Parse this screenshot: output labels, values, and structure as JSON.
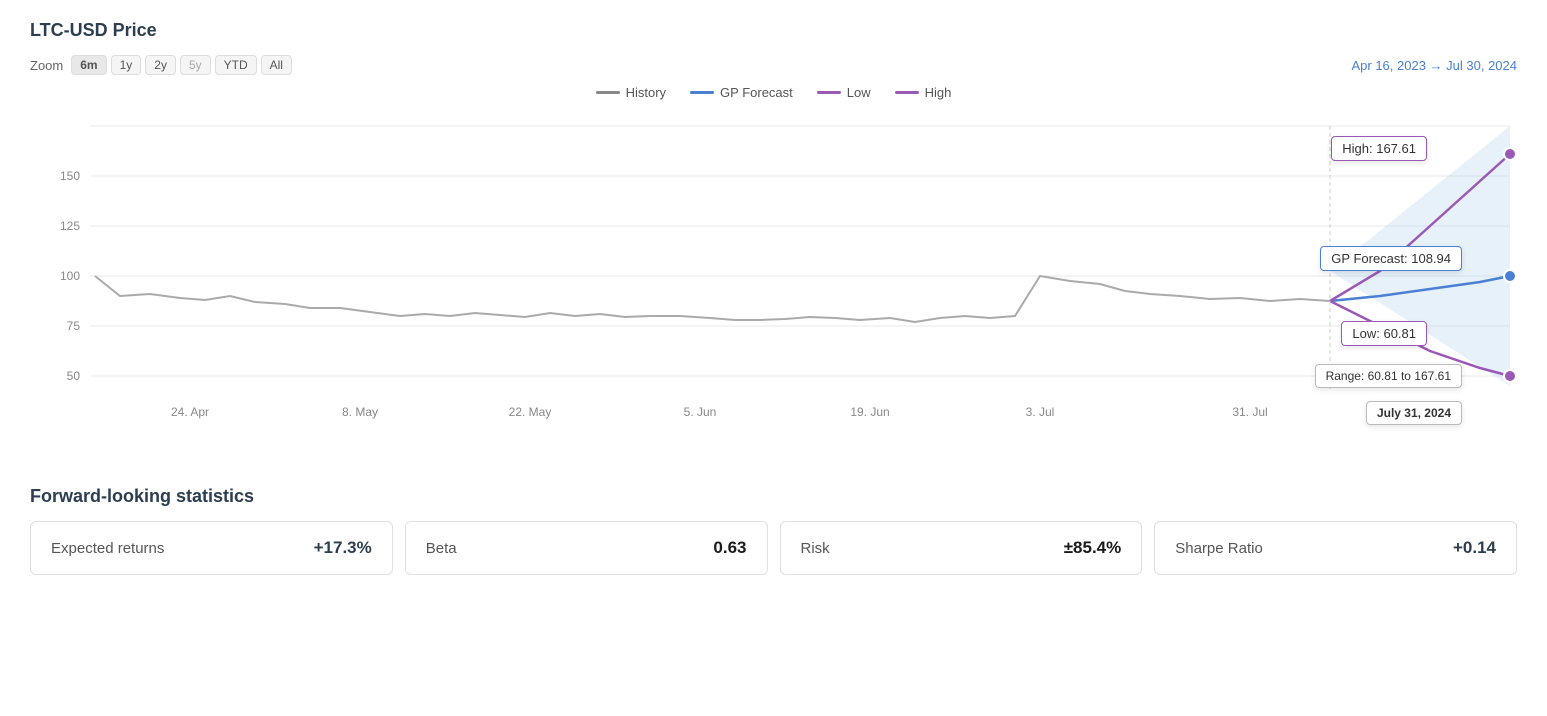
{
  "title": "LTC-USD Price",
  "zoom": {
    "label": "Zoom",
    "buttons": [
      "6m",
      "1y",
      "2y",
      "5y",
      "YTD",
      "All"
    ],
    "active": "6m"
  },
  "date_range": "Apr 16, 2023 → Jul 30, 2024",
  "legend": [
    {
      "label": "History",
      "color": "#888888",
      "style": "solid"
    },
    {
      "label": "GP Forecast",
      "color": "#4a7fd4",
      "style": "solid"
    },
    {
      "label": "Low",
      "color": "#9b59b6",
      "style": "solid"
    },
    {
      "label": "High",
      "color": "#9b59b6",
      "style": "solid"
    }
  ],
  "x_labels": [
    "24. Apr",
    "8. May",
    "22. May",
    "5. Jun",
    "19. Jun",
    "3. Jul",
    "31. Jul"
  ],
  "y_labels": [
    "50",
    "75",
    "100",
    "125",
    "150"
  ],
  "tooltips": {
    "high": "High: 167.61",
    "gp_forecast": "GP Forecast: 108.94",
    "low": "Low: 60.81",
    "range": "Range: 60.81 to 167.61",
    "date": "July 31, 2024"
  },
  "stats": {
    "title": "Forward-looking statistics",
    "cards": [
      {
        "label": "Expected returns",
        "value": "+17.3%"
      },
      {
        "label": "Beta",
        "value": "0.63"
      },
      {
        "label": "Risk",
        "value": "±85.4%"
      },
      {
        "label": "Sharpe Ratio",
        "value": "+0.14"
      }
    ]
  }
}
